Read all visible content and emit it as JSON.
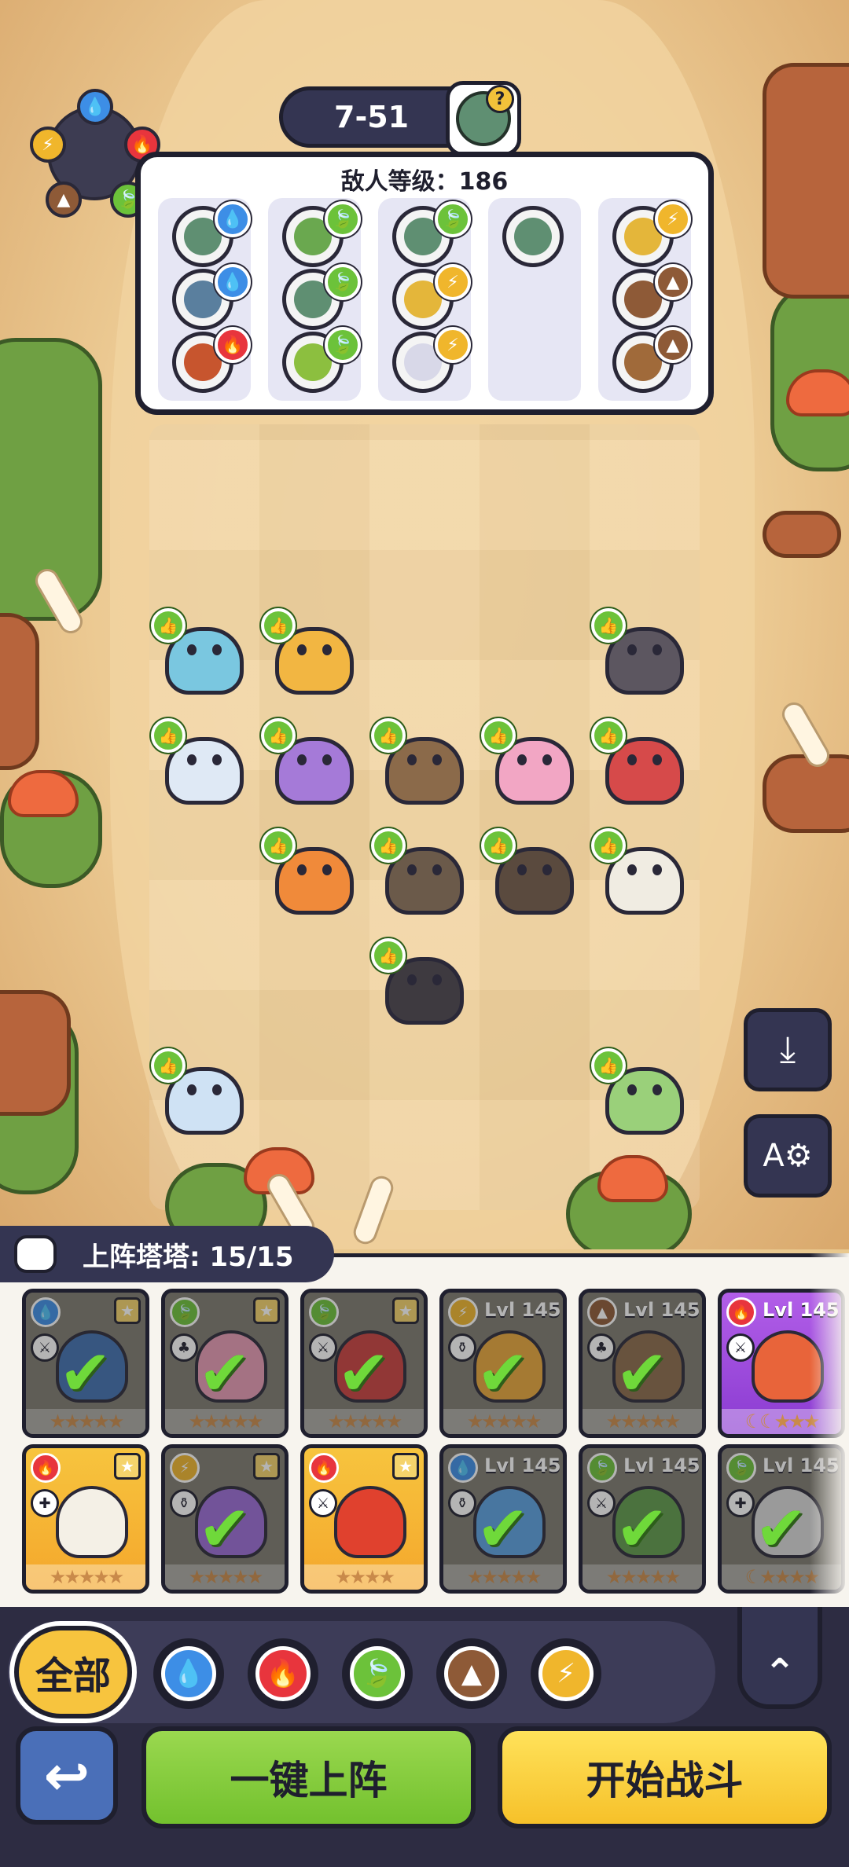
{
  "stage": {
    "label": "7-51",
    "boss_hint": "?"
  },
  "enemy_panel": {
    "level_text": "敌人等级：186",
    "columns": [
      {
        "enemies": [
          {
            "element": "water",
            "color": "#5f8f72"
          },
          {
            "element": "water",
            "color": "#5a7f9e"
          },
          {
            "element": "fire",
            "color": "#c7552e"
          }
        ]
      },
      {
        "enemies": [
          {
            "element": "nature",
            "color": "#6aa84f"
          },
          {
            "element": "nature",
            "color": "#5f8f72"
          },
          {
            "element": "nature",
            "color": "#8cbf3f"
          }
        ]
      },
      {
        "enemies": [
          {
            "element": "nature",
            "color": "#5f8f72"
          },
          {
            "element": "thunder",
            "color": "#e4b63a"
          },
          {
            "element": "thunder",
            "color": "#d8d8e8"
          }
        ]
      },
      {
        "enemies": [
          {
            "element": "none",
            "color": "#5f8f72"
          }
        ]
      },
      {
        "enemies": [
          {
            "element": "thunder",
            "color": "#e4b63a"
          },
          {
            "element": "earth",
            "color": "#8e5a37"
          },
          {
            "element": "earth",
            "color": "#a06a3a"
          }
        ]
      }
    ]
  },
  "element_icons": {
    "water": "💧",
    "fire": "🔥",
    "nature": "🍃",
    "earth": "▲",
    "thunder": "⚡"
  },
  "deck": {
    "title": "上阵塔塔: 15/15",
    "cards_row1": [
      {
        "element": "water",
        "style": "used",
        "role": "⚔",
        "level": "",
        "fav": true,
        "color": "#3f6fb0",
        "stars": "★★★★★"
      },
      {
        "element": "nature",
        "style": "used",
        "role": "♣",
        "level": "",
        "fav": true,
        "color": "#e79ab4",
        "stars": "★★★★★"
      },
      {
        "element": "nature",
        "style": "used",
        "role": "⚔",
        "level": "",
        "fav": true,
        "color": "#c9403e",
        "stars": "★★★★★"
      },
      {
        "element": "thunder",
        "style": "used",
        "role": "⚱",
        "level": "Lvl 145",
        "fav": false,
        "color": "#e8a73a",
        "stars": "★★★★★"
      },
      {
        "element": "earth",
        "style": "used",
        "role": "♣",
        "level": "Lvl 145",
        "fav": false,
        "color": "#8a6a4a",
        "stars": "★★★★★"
      },
      {
        "element": "fire",
        "style": "purple",
        "role": "⚔",
        "level": "Lvl 145",
        "fav": false,
        "color": "#e8643a",
        "stars": "☾☾★★★"
      }
    ],
    "cards_row2": [
      {
        "element": "fire",
        "style": "gold",
        "role": "✚",
        "level": "",
        "fav": true,
        "color": "#f4f0e6",
        "stars": "★★★★★"
      },
      {
        "element": "thunder",
        "style": "used",
        "role": "⚱",
        "level": "",
        "fav": true,
        "color": "#9a6bd6",
        "stars": "★★★★★"
      },
      {
        "element": "fire",
        "style": "gold",
        "role": "⚔",
        "level": "",
        "fav": true,
        "color": "#e0412e",
        "stars": "★★★★"
      },
      {
        "element": "water",
        "style": "used",
        "role": "⚱",
        "level": "Lvl 145",
        "fav": false,
        "color": "#5aa0e0",
        "stars": "★★★★★"
      },
      {
        "element": "nature",
        "style": "used",
        "role": "⚔",
        "level": "Lvl 145",
        "fav": false,
        "color": "#5f9a4a",
        "stars": "★★★★★"
      },
      {
        "element": "nature",
        "style": "used",
        "role": "✚",
        "level": "Lvl 145",
        "fav": false,
        "color": "#d8d8d8",
        "stars": "☾★★★★"
      }
    ]
  },
  "filters": {
    "all_label": "全部",
    "items": [
      {
        "name": "water",
        "color": "#3d8ee6"
      },
      {
        "name": "fire",
        "color": "#e8353d"
      },
      {
        "name": "nature",
        "color": "#6cc23a"
      },
      {
        "name": "earth",
        "color": "#8e5a37"
      },
      {
        "name": "thunder",
        "color": "#f0b62c"
      }
    ],
    "collapse_icon": "⌃"
  },
  "buttons": {
    "back_icon": "↩",
    "auto_deploy": "一键上阵",
    "start_battle": "开始战斗",
    "save_lineup_icon": "⤓",
    "settings_icon": "A⚙"
  },
  "units": [
    {
      "name": "crab-unit",
      "color": "#7ac7e0"
    },
    {
      "name": "lion-unit",
      "color": "#f2b642"
    },
    {
      "name": "mole-unit",
      "color": "#5c5660"
    },
    {
      "name": "narwhal-unit",
      "color": "#dfe9f5"
    },
    {
      "name": "cat-unit",
      "color": "#a57ad8"
    },
    {
      "name": "hedgehog-unit",
      "color": "#8b6a4a"
    },
    {
      "name": "seahorse-unit",
      "color": "#f2a6c4"
    },
    {
      "name": "flower-unit",
      "color": "#d64a4a"
    },
    {
      "name": "tiger-unit",
      "color": "#f08a3a"
    },
    {
      "name": "raccoon-unit",
      "color": "#6b5a4a"
    },
    {
      "name": "monkey-unit",
      "color": "#5a4a3e"
    },
    {
      "name": "plant-unit",
      "color": "#f0ece2"
    },
    {
      "name": "boar-unit",
      "color": "#3e3a40"
    },
    {
      "name": "cow-unit",
      "color": "#cfe2f4"
    },
    {
      "name": "fox-unit",
      "color": "#9ad07a"
    }
  ]
}
